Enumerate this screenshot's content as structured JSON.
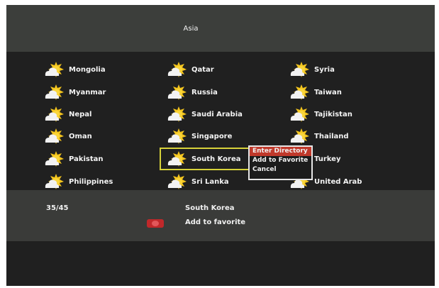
{
  "header": {
    "title": "Asia"
  },
  "countries": [
    [
      "Mongolia",
      "Qatar",
      "Syria"
    ],
    [
      "Myanmar",
      "Russia",
      "Taiwan"
    ],
    [
      "Nepal",
      "Saudi Arabia",
      "Tajikistan"
    ],
    [
      "Oman",
      "Singapore",
      "Thailand"
    ],
    [
      "Pakistan",
      "South Korea",
      "Turkey"
    ],
    [
      "Philippines",
      "Sri Lanka",
      "United Arab"
    ]
  ],
  "selected": {
    "row": 4,
    "col": 1
  },
  "popup": {
    "items": [
      "Enter Directory",
      "Add to Favorite",
      "Cancel"
    ],
    "active_index": 0
  },
  "footer": {
    "counter": "35/45",
    "selected_name": "South Korea",
    "favorite_label": "Add to favorite"
  },
  "colors": {
    "highlight": "#d7d23a",
    "popup_active": "#c0392b",
    "red_key": "#c0282a"
  }
}
